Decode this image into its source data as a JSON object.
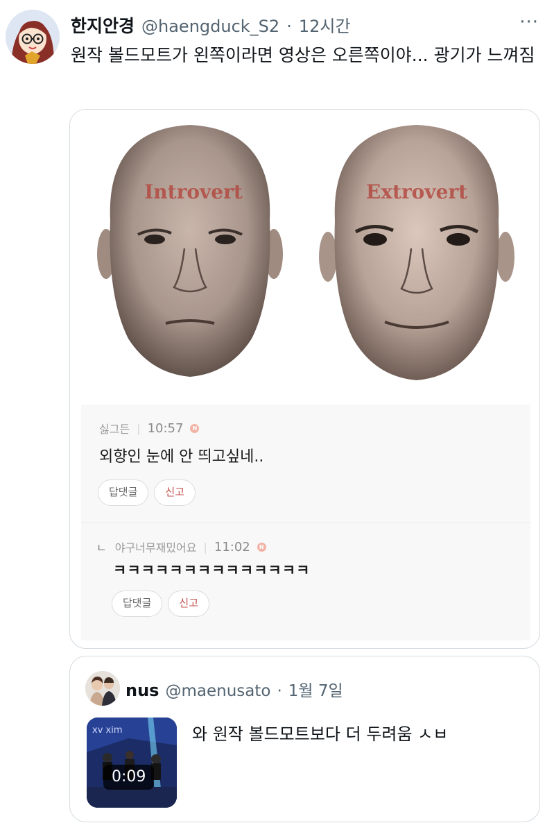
{
  "tweet": {
    "display_name": "한지안경",
    "handle": "@haengduck_S2",
    "separator": "·",
    "time": "12시간",
    "more_label": "···",
    "text": "원작 볼드모트가 왼쪽이라면 영상은 오른쪽이야... 광기가 느껴짐"
  },
  "media": {
    "faces": [
      {
        "label": "Introvert"
      },
      {
        "label": "Extrovert"
      }
    ],
    "comments": [
      {
        "author": "싫그든",
        "time": "10:57",
        "badge": "N",
        "text": "외향인 눈에 안 띄고싶네..",
        "reply_label": "답댓글",
        "report_label": "신고"
      },
      {
        "reply_marker": "ㄴ",
        "author": "야구너무재밌어요",
        "time": "11:02",
        "badge": "N",
        "text": "ㅋㅋㅋㅋㅋㅋㅋㅋㅋㅋㅋㅋㅋㅋ",
        "reply_label": "답댓글",
        "report_label": "신고"
      }
    ]
  },
  "quote": {
    "display_name": "nus",
    "handle": "@maenusato",
    "separator": "·",
    "date": "1월 7일",
    "video_duration": "0:09",
    "thumbnail_text": "xv xim",
    "text": "와 원작 볼드모트보다 더 두려움 ㅅㅂ"
  },
  "colors": {
    "text_primary": "#0f1419",
    "text_secondary": "#536471",
    "border": "#d5dbe0",
    "report": "#c0504d",
    "face_label": "#b2473f"
  }
}
